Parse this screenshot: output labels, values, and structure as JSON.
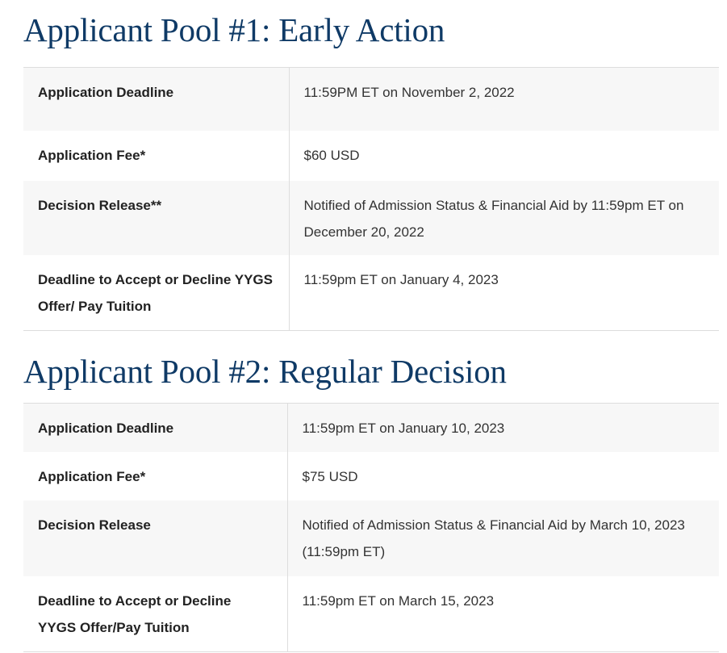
{
  "pool1": {
    "title": "Applicant Pool #1: Early Action",
    "rows": [
      {
        "label": "Application Deadline",
        "value": "11:59PM ET on November 2, 2022"
      },
      {
        "label": "Application Fee*",
        "value": "$60 USD"
      },
      {
        "label": "Decision Release**",
        "value": "Notified of Admission Status & Financial Aid by 11:59pm ET on December 20, 2022"
      },
      {
        "label": "Deadline to Accept or Decline YYGS Offer/ Pay Tuition",
        "value": "11:59pm ET on January 4, 2023"
      }
    ]
  },
  "pool2": {
    "title": "Applicant Pool #2: Regular Decision",
    "rows": [
      {
        "label": "Application Deadline",
        "value": "11:59pm ET on January 10, 2023"
      },
      {
        "label": "Application Fee*",
        "value": "$75 USD"
      },
      {
        "label": "Decision Release",
        "value": "Notified of Admission Status & Financial Aid by March 10, 2023 (11:59pm ET)"
      },
      {
        "label": "Deadline to Accept or Decline YYGS Offer/Pay Tuition",
        "value": "11:59pm ET on March 15, 2023"
      }
    ]
  }
}
